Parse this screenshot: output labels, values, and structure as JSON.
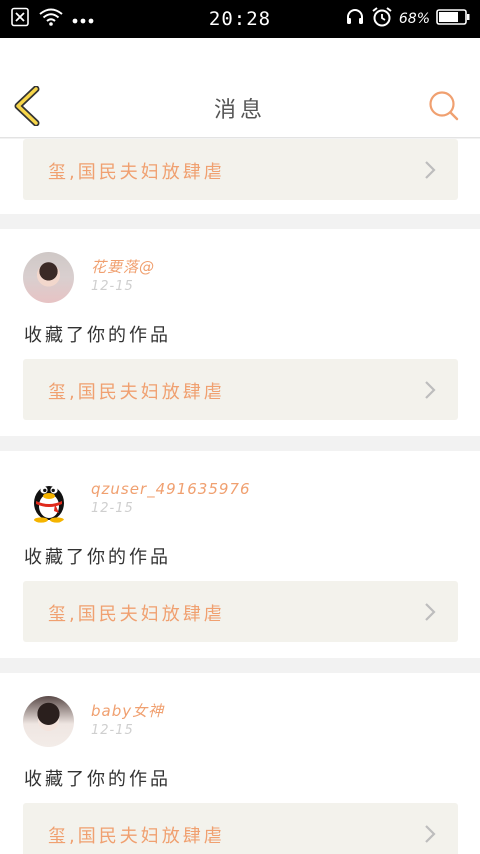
{
  "status_bar": {
    "time": "20:28",
    "battery_percent": "68%",
    "icons": [
      "sim-off-icon",
      "wifi-icon",
      "more-dots-icon",
      "headphones-icon",
      "alarm-icon",
      "battery-icon"
    ]
  },
  "header": {
    "title": "消息",
    "back_icon": "chevron-left-icon",
    "search_icon": "search-icon"
  },
  "colors": {
    "accent": "#f0a070",
    "back_arrow_fill": "#f7d64a",
    "link_box_bg": "#f3f2ec",
    "divider_bg": "#f2f2f2"
  },
  "feed": {
    "top_partial": {
      "link_text": "玺,国民夫妇放肆虐"
    },
    "items": [
      {
        "user_name": "花要落@",
        "date": "12-15",
        "avatar": "avatar-photo",
        "message": "收藏了你的作品",
        "link_text": "玺,国民夫妇放肆虐"
      },
      {
        "user_name": "qzuser_491635976",
        "date": "12-15",
        "avatar": "qq-penguin-avatar",
        "message": "收藏了你的作品",
        "link_text": "玺,国民夫妇放肆虐"
      },
      {
        "user_name": "baby女神",
        "date": "12-15",
        "avatar": "avatar-photo",
        "message": "收藏了你的作品",
        "link_text": "玺,国民夫妇放肆虐"
      }
    ]
  }
}
